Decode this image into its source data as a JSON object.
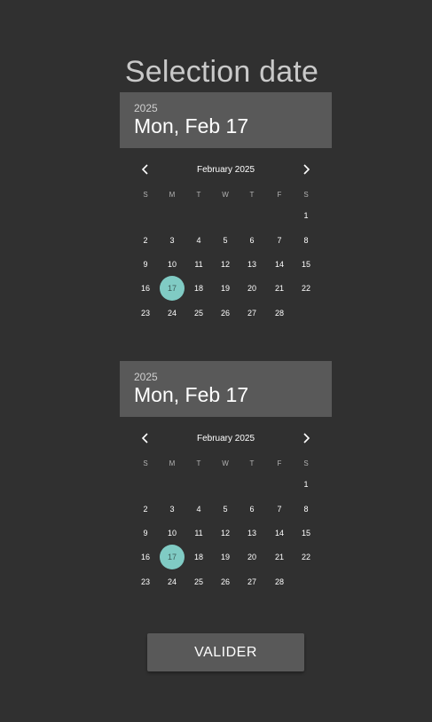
{
  "page": {
    "title": "Selection date"
  },
  "pickers": [
    {
      "header_year": "2025",
      "header_date": "Mon, Feb 17",
      "month_label": "February 2025",
      "weekdays": [
        "S",
        "M",
        "T",
        "W",
        "T",
        "F",
        "S"
      ],
      "first_weekday_index": 6,
      "days_in_month": 28,
      "selected_day": 17,
      "prev_icon": "chevron-left-icon",
      "next_icon": "chevron-right-icon"
    },
    {
      "header_year": "2025",
      "header_date": "Mon, Feb 17",
      "month_label": "February 2025",
      "weekdays": [
        "S",
        "M",
        "T",
        "W",
        "T",
        "F",
        "S"
      ],
      "first_weekday_index": 6,
      "days_in_month": 28,
      "selected_day": 17,
      "prev_icon": "chevron-left-icon",
      "next_icon": "chevron-right-icon"
    }
  ],
  "actions": {
    "validate_label": "VALIDER"
  },
  "colors": {
    "background": "#303030",
    "header_bg": "#595959",
    "selected_day_bg": "#80cbc4",
    "button_bg": "#595959"
  }
}
